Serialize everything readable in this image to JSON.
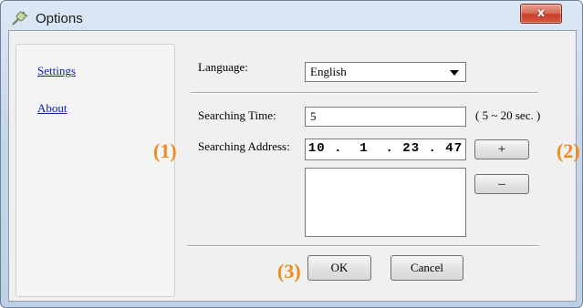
{
  "window": {
    "title": "Options",
    "close_label": "x"
  },
  "sidebar": {
    "items": [
      {
        "label": "Settings"
      },
      {
        "label": "About"
      }
    ]
  },
  "form": {
    "language_label": "Language:",
    "language_value": "English",
    "search_time_label": "Searching Time:",
    "search_time_value": "5",
    "search_time_hint": "( 5 ~ 20 sec. )",
    "search_address_label": "Searching Address:",
    "search_address_value": "10 .  1  . 23 . 47",
    "add_label": "+",
    "remove_label": "–",
    "ok_label": "OK",
    "cancel_label": "Cancel"
  },
  "annotations": {
    "m1": "(1)",
    "m2": "(2)",
    "m3": "(3)"
  },
  "colors": {
    "annotation": "#f08a1e",
    "link": "#0b1fa8",
    "close": "#c6422a"
  },
  "icons": {
    "app": "plug-icon"
  }
}
